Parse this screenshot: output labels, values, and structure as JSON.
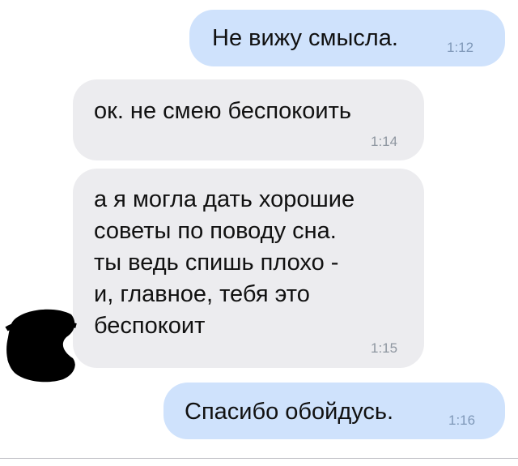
{
  "messages": [
    {
      "direction": "outgoing",
      "text": "Не вижу смысла.",
      "time": "1:12"
    },
    {
      "direction": "incoming",
      "text": "ок. не смею беспокоить",
      "time": "1:14"
    },
    {
      "direction": "incoming",
      "lines": [
        "а я могла дать хорошие",
        "советы по поводу сна.",
        "ты ведь спишь плохо -",
        "и, главное, тебя это",
        "беспокоит"
      ],
      "time": "1:15"
    },
    {
      "direction": "outgoing",
      "text": "Спасибо обойдусь.",
      "time": "1:16"
    }
  ],
  "colors": {
    "outgoing_bubble": "#cfe2fc",
    "incoming_bubble": "#ececef",
    "timestamp": "#8e96a0",
    "redaction": "#000000"
  },
  "icons": {
    "avatar": "redacted-avatar-icon"
  }
}
